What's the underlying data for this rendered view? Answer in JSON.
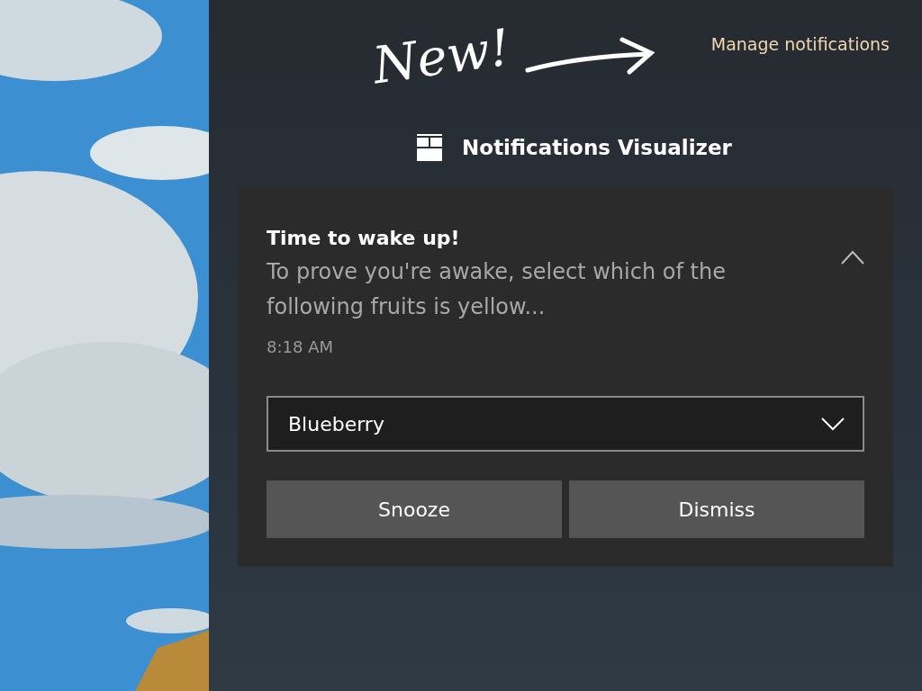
{
  "annotation": {
    "text": "New!"
  },
  "manage_link": "Manage notifications",
  "app": {
    "name": "Notifications Visualizer"
  },
  "notification": {
    "title": "Time to wake up!",
    "body": "To prove you're awake, select which of the following fruits is yellow...",
    "time": "8:18 AM",
    "expanded": true,
    "dropdown": {
      "value": "Blueberry"
    },
    "buttons": [
      "Snooze",
      "Dismiss"
    ]
  }
}
